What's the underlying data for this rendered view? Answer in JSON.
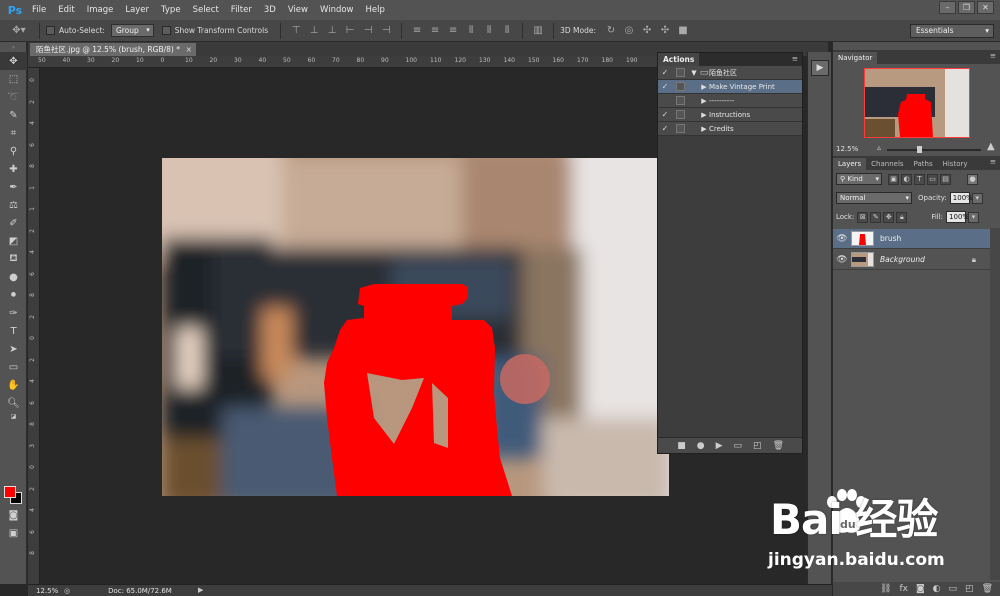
{
  "app": {
    "logo": "Ps",
    "menu": [
      "File",
      "Edit",
      "Image",
      "Layer",
      "Type",
      "Select",
      "Filter",
      "3D",
      "View",
      "Window",
      "Help"
    ],
    "window_controls": [
      "–",
      "❐",
      "✕"
    ]
  },
  "options": {
    "auto_select_label": "Auto-Select:",
    "auto_select_value": "Group",
    "show_transform_label": "Show Transform Controls",
    "mode_3d_label": "3D Mode:",
    "workspace": "Essentials"
  },
  "document": {
    "tab_title": "陌鱼社区.jpg @ 12.5% (brush, RGB/8) *",
    "ruler_top": [
      "50",
      "40",
      "30",
      "20",
      "10",
      "0",
      "10",
      "20",
      "30",
      "40",
      "50",
      "60",
      "70",
      "80",
      "90",
      "100",
      "110",
      "120",
      "130",
      "140",
      "150",
      "160",
      "170",
      "180",
      "190"
    ],
    "ruler_left": [
      "0",
      "2",
      "4",
      "6",
      "8",
      "1",
      "1",
      "2",
      "4",
      "6",
      "8",
      "2",
      "0",
      "2",
      "4",
      "6",
      "8",
      "3",
      "0",
      "2",
      "4",
      "6",
      "8"
    ],
    "brush_color": "#ff0000"
  },
  "actions": {
    "title": "Actions",
    "items": [
      {
        "label": "陌鱼社区",
        "checked": true,
        "type": "folder",
        "expanded": true
      },
      {
        "label": "Make Vintage Print",
        "checked": true,
        "type": "action",
        "selected": true
      },
      {
        "label": "----------",
        "checked": false,
        "type": "action"
      },
      {
        "label": "Instructions",
        "checked": true,
        "type": "action"
      },
      {
        "label": "Credits",
        "checked": true,
        "type": "action"
      }
    ]
  },
  "navigator": {
    "title": "Navigator",
    "zoom": "12.5%"
  },
  "layers_panel": {
    "tabs": [
      "Layers",
      "Channels",
      "Paths",
      "History"
    ],
    "active_tab": "Layers",
    "filter_kind": "Kind",
    "blend_mode": "Normal",
    "opacity_label": "Opacity:",
    "opacity": "100%",
    "lock_label": "Lock:",
    "fill_label": "Fill:",
    "fill": "100%",
    "layers": [
      {
        "name": "brush",
        "selected": true,
        "visible": true
      },
      {
        "name": "Background",
        "selected": false,
        "visible": true,
        "locked": true
      }
    ]
  },
  "status": {
    "zoom": "12.5%",
    "doc": "Doc: 65.0M/72.6M"
  },
  "watermark": {
    "logo": "Bai  经验",
    "url": "jingyan.baidu.com"
  }
}
